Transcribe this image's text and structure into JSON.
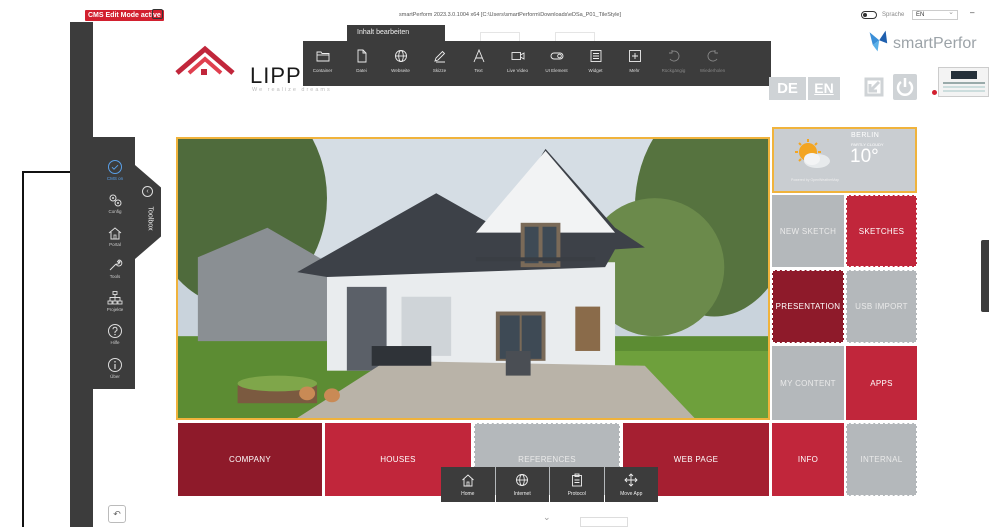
{
  "topbar": {
    "cms_badge": "CMS Edit Mode active",
    "window_title": "smartPerform 2023.3.0.1004 x64 [C:\\Users\\smartPerform\\Downloads\\eDSa_P01_TileStyle]",
    "lang_label": "Sprache",
    "lang_value": "EN",
    "minimize": "–"
  },
  "toolbox": {
    "label": "Toolbox",
    "collapse": "‹",
    "items": [
      {
        "label": "CMS on",
        "icon": "check-circle-icon"
      },
      {
        "label": "Config",
        "icon": "gears-icon"
      },
      {
        "label": "Portal",
        "icon": "home-icon"
      },
      {
        "label": "Tools",
        "icon": "wrench-icon"
      },
      {
        "label": "Projekte",
        "icon": "sitemap-icon"
      },
      {
        "label": "Hilfe",
        "icon": "help-icon"
      },
      {
        "label": "Über",
        "icon": "info-icon"
      }
    ]
  },
  "logo": {
    "name": "LIPPE",
    "tagline": "We realize dreams"
  },
  "edit_toolbar": {
    "tab": "Inhalt bearbeiten",
    "buttons": [
      {
        "label": "Container",
        "icon": "folder-icon",
        "enabled": true
      },
      {
        "label": "Datei",
        "icon": "file-icon",
        "enabled": true
      },
      {
        "label": "Webseite",
        "icon": "globe-icon",
        "enabled": true
      },
      {
        "label": "Skizze",
        "icon": "pen-icon",
        "enabled": true
      },
      {
        "label": "Text",
        "icon": "text-icon",
        "enabled": true
      },
      {
        "label": "Live Video",
        "icon": "video-icon",
        "enabled": true
      },
      {
        "label": "UI Element",
        "icon": "toggle-icon",
        "enabled": true
      },
      {
        "label": "Widget",
        "icon": "widget-icon",
        "enabled": true
      },
      {
        "label": "Mehr",
        "icon": "plus-icon",
        "enabled": true
      },
      {
        "label": "Rückgängig",
        "icon": "undo-icon",
        "enabled": false
      },
      {
        "label": "Wiederholen",
        "icon": "redo-icon",
        "enabled": false
      }
    ]
  },
  "header_right": {
    "lang_de": "DE",
    "lang_en": "EN",
    "brand": "smartPerfor"
  },
  "weather": {
    "city": "BERLIN",
    "condition": "PARTLY CLOUDY",
    "temperature": "10°",
    "footer": "Powered by OpenWeatherMap"
  },
  "tiles": {
    "new_sketch": "NEW SKETCH",
    "sketches": "SKETCHES",
    "presentation": "PRESENTATION",
    "usb_import": "USB IMPORT",
    "my_content": "MY CONTENT",
    "apps": "APPS",
    "company": "COMPANY",
    "houses": "HOUSES",
    "references": "REFERENCES",
    "web_page": "WEB PAGE",
    "info": "INFO",
    "internal": "INTERNAL"
  },
  "dock": {
    "buttons": [
      {
        "label": "Home",
        "icon": "home-icon"
      },
      {
        "label": "Internet",
        "icon": "globe-icon"
      },
      {
        "label": "Protocol",
        "icon": "clipboard-icon"
      },
      {
        "label": "Move App",
        "icon": "move-icon"
      }
    ]
  },
  "colors": {
    "dark": "#3c3c3c",
    "red": "#c1263b",
    "dark_red": "#8e1a2a",
    "grey_tile": "#b4b8bb",
    "highlight": "#f0b33c",
    "accent_blue": "#5aa0e8"
  }
}
